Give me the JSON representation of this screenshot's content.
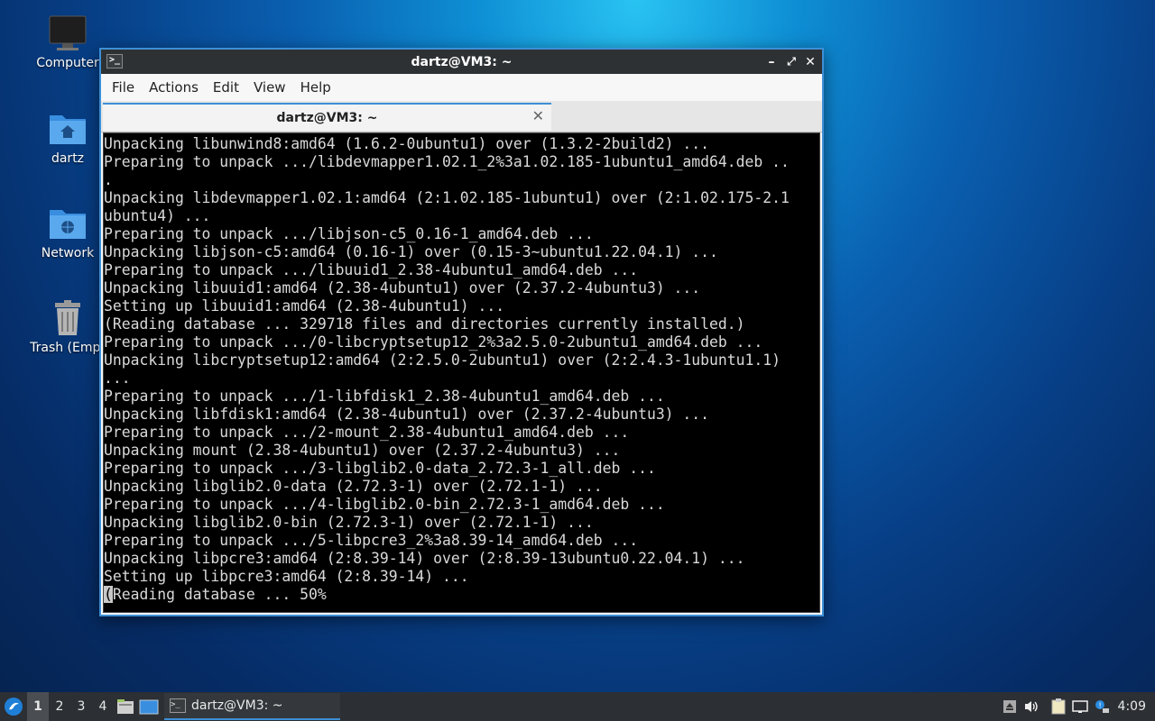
{
  "desktop": {
    "icons": [
      {
        "label": "Computer"
      },
      {
        "label": "dartz"
      },
      {
        "label": "Network"
      },
      {
        "label": "Trash (Empt"
      }
    ]
  },
  "window": {
    "title": "dartz@VM3: ~",
    "menu": [
      "File",
      "Actions",
      "Edit",
      "View",
      "Help"
    ],
    "tab_title": "dartz@VM3: ~",
    "terminal_lines": [
      "Unpacking libunwind8:amd64 (1.6.2-0ubuntu1) over (1.3.2-2build2) ...",
      "Preparing to unpack .../libdevmapper1.02.1_2%3a1.02.185-1ubuntu1_amd64.deb ..",
      ".",
      "Unpacking libdevmapper1.02.1:amd64 (2:1.02.185-1ubuntu1) over (2:1.02.175-2.1",
      "ubuntu4) ...",
      "Preparing to unpack .../libjson-c5_0.16-1_amd64.deb ...",
      "Unpacking libjson-c5:amd64 (0.16-1) over (0.15-3~ubuntu1.22.04.1) ...",
      "Preparing to unpack .../libuuid1_2.38-4ubuntu1_amd64.deb ...",
      "Unpacking libuuid1:amd64 (2.38-4ubuntu1) over (2.37.2-4ubuntu3) ...",
      "Setting up libuuid1:amd64 (2.38-4ubuntu1) ...",
      "(Reading database ... 329718 files and directories currently installed.)",
      "Preparing to unpack .../0-libcryptsetup12_2%3a2.5.0-2ubuntu1_amd64.deb ...",
      "Unpacking libcryptsetup12:amd64 (2:2.5.0-2ubuntu1) over (2:2.4.3-1ubuntu1.1)",
      "...",
      "Preparing to unpack .../1-libfdisk1_2.38-4ubuntu1_amd64.deb ...",
      "Unpacking libfdisk1:amd64 (2.38-4ubuntu1) over (2.37.2-4ubuntu3) ...",
      "Preparing to unpack .../2-mount_2.38-4ubuntu1_amd64.deb ...",
      "Unpacking mount (2.38-4ubuntu1) over (2.37.2-4ubuntu3) ...",
      "Preparing to unpack .../3-libglib2.0-data_2.72.3-1_all.deb ...",
      "Unpacking libglib2.0-data (2.72.3-1) over (2.72.1-1) ...",
      "Preparing to unpack .../4-libglib2.0-bin_2.72.3-1_amd64.deb ...",
      "Unpacking libglib2.0-bin (2.72.3-1) over (2.72.1-1) ...",
      "Preparing to unpack .../5-libpcre3_2%3a8.39-14_amd64.deb ...",
      "Unpacking libpcre3:amd64 (2:8.39-14) over (2:8.39-13ubuntu0.22.04.1) ...",
      "Setting up libpcre3:amd64 (2:8.39-14) ..."
    ],
    "prompt_cursor_char": "(",
    "prompt_rest": "Reading database ... 50%"
  },
  "taskbar": {
    "workspaces": [
      "1",
      "2",
      "3",
      "4"
    ],
    "active_workspace": "1",
    "task_label": "dartz@VM3: ~",
    "clock": "4:09"
  },
  "colors": {
    "accent": "#3d8fd6",
    "titlebar": "#2e3133",
    "taskbar": "#2c2f33",
    "terminal_bg": "#000000",
    "terminal_fg": "#d9d9d9"
  }
}
